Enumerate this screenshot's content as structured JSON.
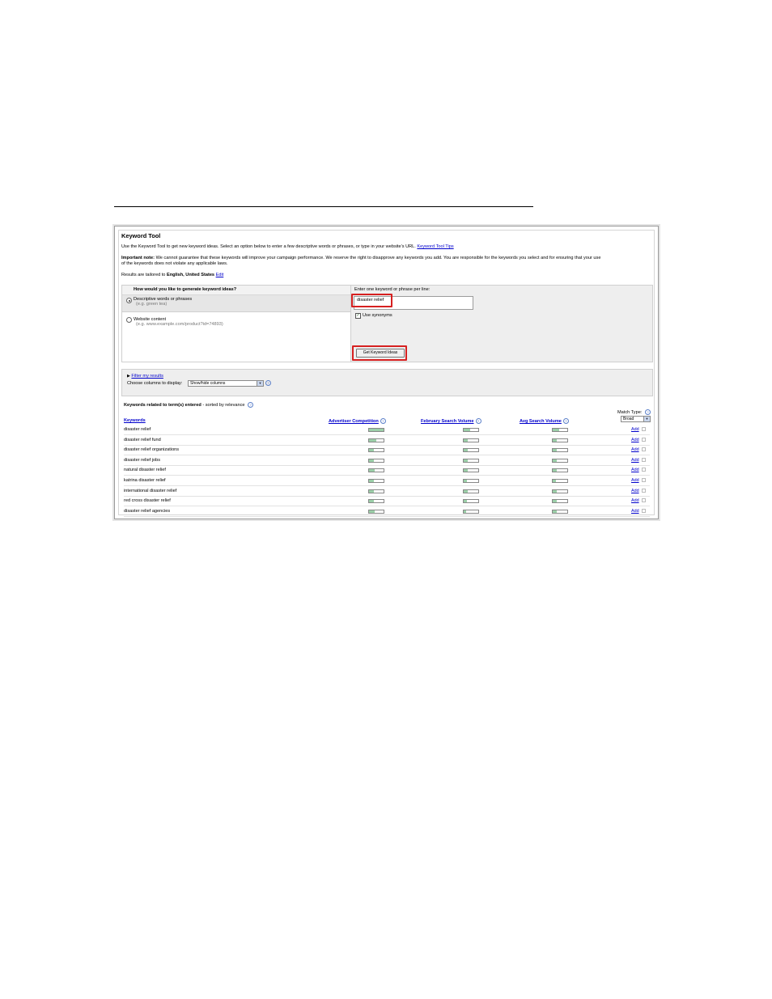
{
  "page": {
    "heading": "Keyword Tool"
  },
  "intro": {
    "text": "Use the Keyword Tool to get new keyword ideas. Select an option below to enter a few descriptive words or phrases, or type in your website's URL.",
    "tips_link": "Keyword Tool Tips"
  },
  "note": {
    "label": "Important note:",
    "line1": "We cannot guarantee that these keywords will improve your campaign performance. We reserve the right to disapprove any keywords you add. You are responsible for the keywords you select and for ensuring that your use",
    "line2": "of the keywords does not violate any applicable laws."
  },
  "tailored": {
    "prefix": "Results are tailored to",
    "value": "English, United States",
    "edit_link": "Edit"
  },
  "generate": {
    "question": "How would you like to generate keyword ideas?",
    "options": [
      {
        "label": "Descriptive words or phrases",
        "hint": "(e.g. green tea)",
        "selected": true
      },
      {
        "label": "Website content",
        "hint": "(e.g. www.example.com/product?id=74893)",
        "selected": false
      }
    ],
    "input_label": "Enter one keyword or phrase per line:",
    "input_value": "disaster relief",
    "synonyms_label": "Use synonyms",
    "synonyms_checked": true,
    "button_label": "Get Keyword Ideas"
  },
  "filter": {
    "link": "Filter my results",
    "columns_label": "Choose columns to display:",
    "columns_value": "Show/hide columns"
  },
  "results": {
    "heading": "Keywords related to term(s) entered",
    "subheading": "- sorted by relevance",
    "match_type_label": "Match Type:",
    "match_type_value": "Broad",
    "columns": [
      "Keywords",
      "Advertiser Competition",
      "February Search Volume",
      "Avg Search Volume"
    ],
    "add_label": "Add",
    "rows": [
      {
        "keyword": "disaster relief",
        "competition": 1.0,
        "february": 0.45,
        "avg": 0.45
      },
      {
        "keyword": "disaster relief fund",
        "competition": 0.5,
        "february": 0.25,
        "avg": 0.25
      },
      {
        "keyword": "disaster relief organizations",
        "competition": 0.35,
        "february": 0.25,
        "avg": 0.25
      },
      {
        "keyword": "disaster relief jobs",
        "competition": 0.35,
        "february": 0.25,
        "avg": 0.25
      },
      {
        "keyword": "natural disaster relief",
        "competition": 0.4,
        "february": 0.25,
        "avg": 0.25
      },
      {
        "keyword": "katrina disaster relief",
        "competition": 0.35,
        "february": 0.2,
        "avg": 0.2
      },
      {
        "keyword": "international disaster relief",
        "competition": 0.35,
        "february": 0.25,
        "avg": 0.25
      },
      {
        "keyword": "red cross disaster relief",
        "competition": 0.35,
        "february": 0.2,
        "avg": 0.25
      },
      {
        "keyword": "disaster relief agencies",
        "competition": 0.4,
        "february": 0.15,
        "avg": 0.25
      }
    ]
  }
}
